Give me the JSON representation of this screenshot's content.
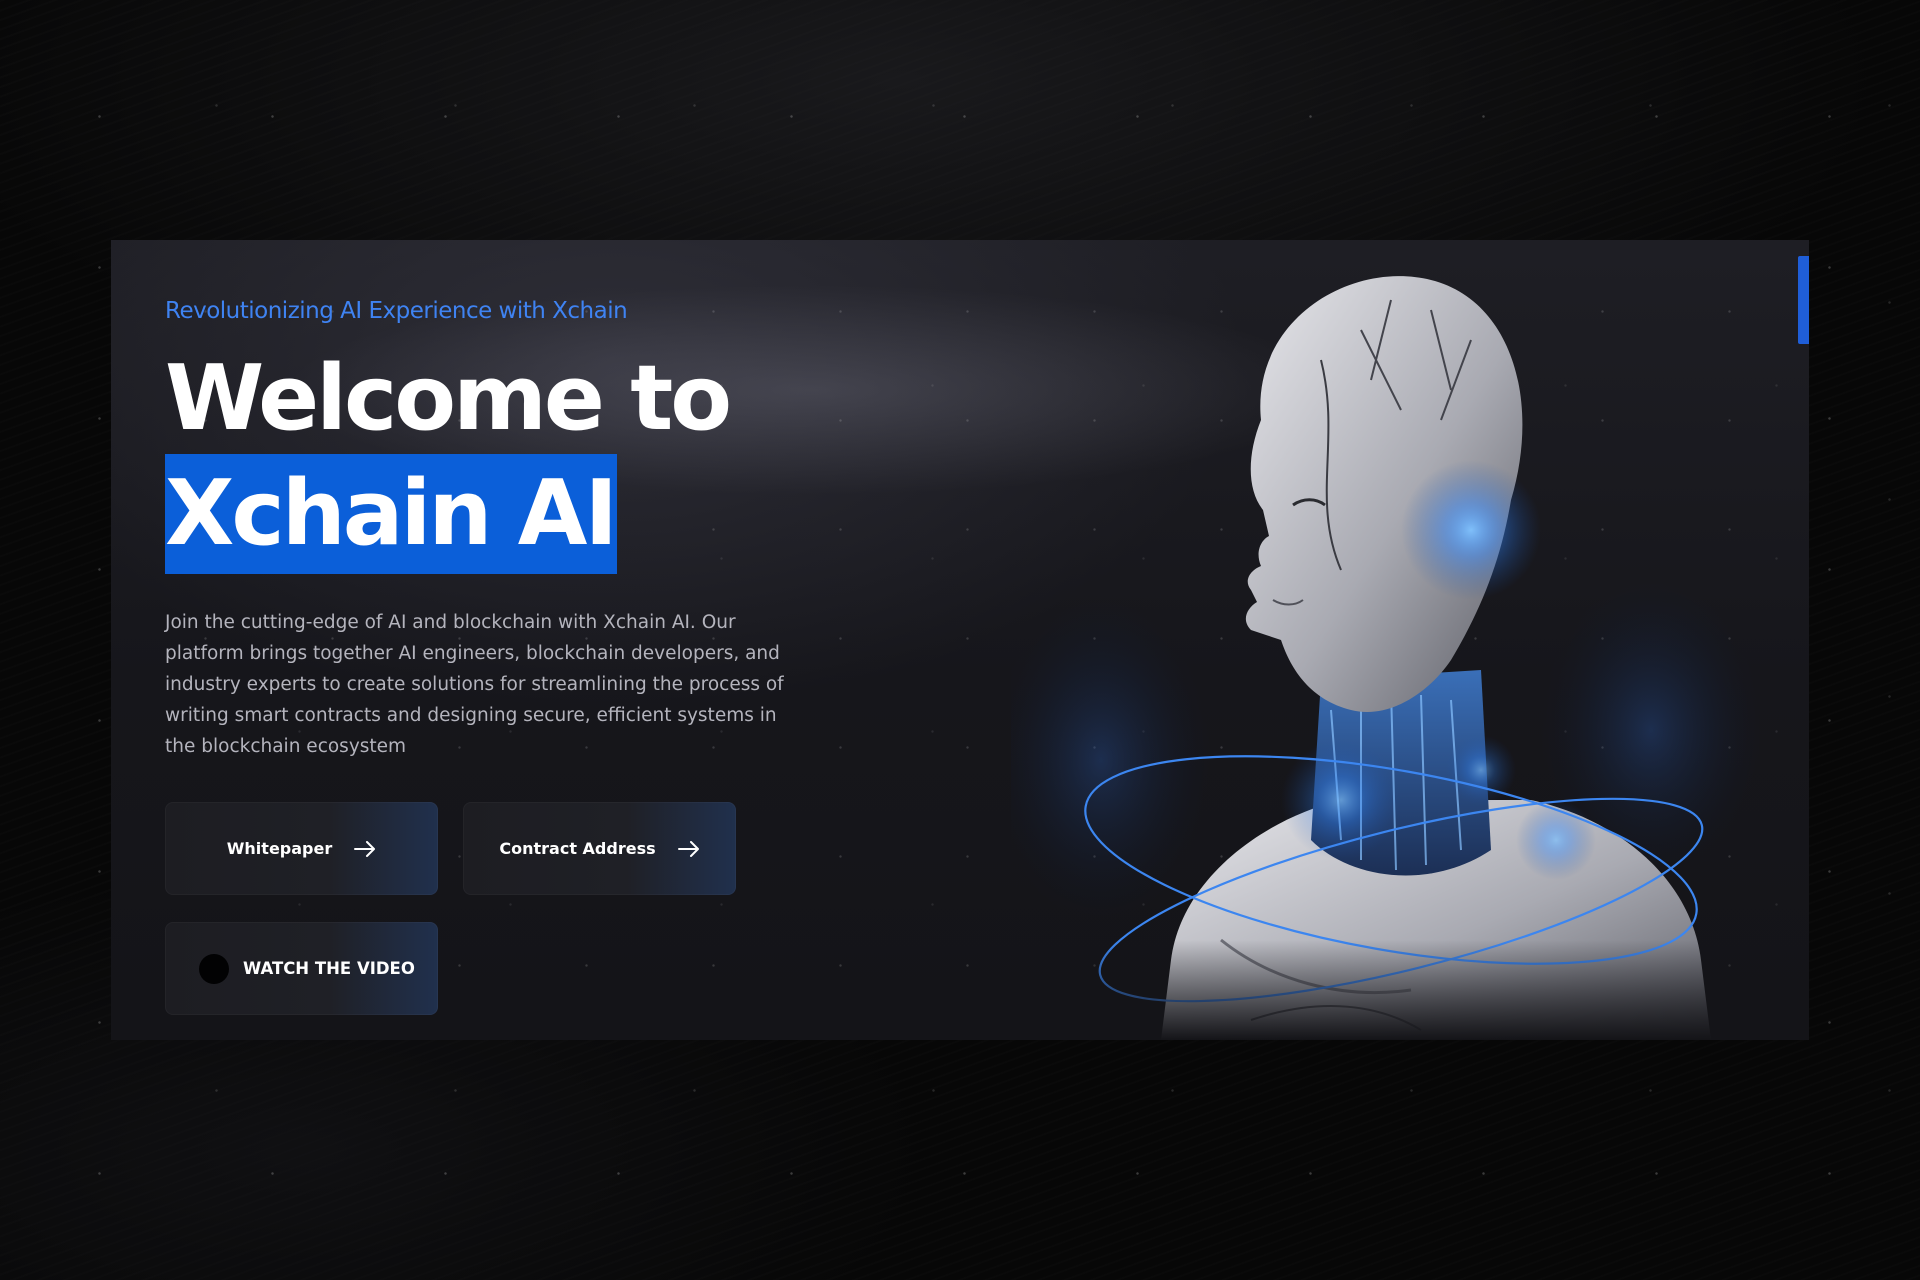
{
  "hero": {
    "tagline": "Revolutionizing AI Experience with Xchain",
    "headline_line1": "Welcome to",
    "headline_line2": "Xchain AI",
    "description": "Join the cutting-edge of AI and blockchain with Xchain AI. Our platform brings together AI engineers, blockchain developers, and industry experts to create solutions for streamlining the process of writing smart contracts and designing secure, efficient systems in the blockchain ecosystem",
    "image_subject": "humanoid-robot-with-orbit-rings"
  },
  "buttons": {
    "whitepaper": "Whitepaper",
    "contract_address": "Contract Address",
    "watch_video": "WATCH THE VIDEO"
  },
  "icons": {
    "arrow": "arrow-right-icon",
    "play": "play-circle-icon"
  },
  "colors": {
    "accent": "#0b5fd9",
    "tagline": "#3f83f2",
    "background": "#070707",
    "panel": "#1a1a1f",
    "orbit": "#3c86f0"
  }
}
